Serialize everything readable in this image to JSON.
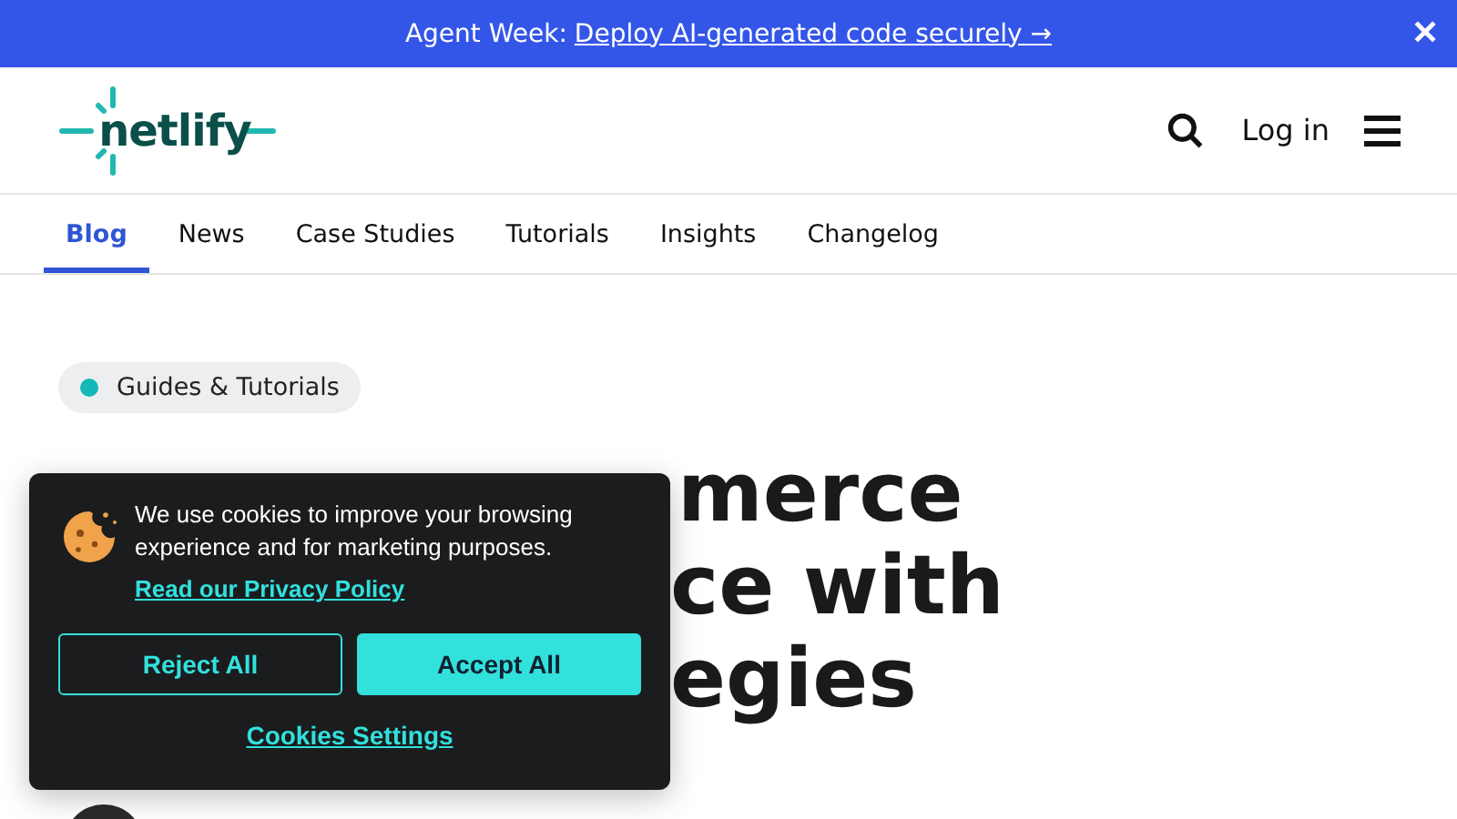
{
  "banner": {
    "label": "Agent Week:",
    "link": "Deploy AI-generated code securely →",
    "close": "✕"
  },
  "header": {
    "logo": "netlify",
    "login": "Log in"
  },
  "nav": [
    {
      "label": "Blog",
      "selected": true
    },
    {
      "label": "News",
      "selected": false
    },
    {
      "label": "Case Studies",
      "selected": false
    },
    {
      "label": "Tutorials",
      "selected": false
    },
    {
      "label": "Insights",
      "selected": false
    },
    {
      "label": "Changelog",
      "selected": false
    }
  ],
  "article": {
    "tag": {
      "label": "Guides & Tutorials",
      "color": "#14b8b8"
    },
    "title_visible_lines": [
      "merce",
      "ce with",
      "egies"
    ]
  },
  "cookie_dialog": {
    "text": "We use cookies to improve your browsing experience and for marketing purposes.",
    "privacy_link": "Read our Privacy Policy",
    "buttons": [
      {
        "label": "Reject All",
        "kind": "outline"
      },
      {
        "label": "Accept All",
        "kind": "filled"
      }
    ],
    "settings_link": "Cookies Settings"
  }
}
